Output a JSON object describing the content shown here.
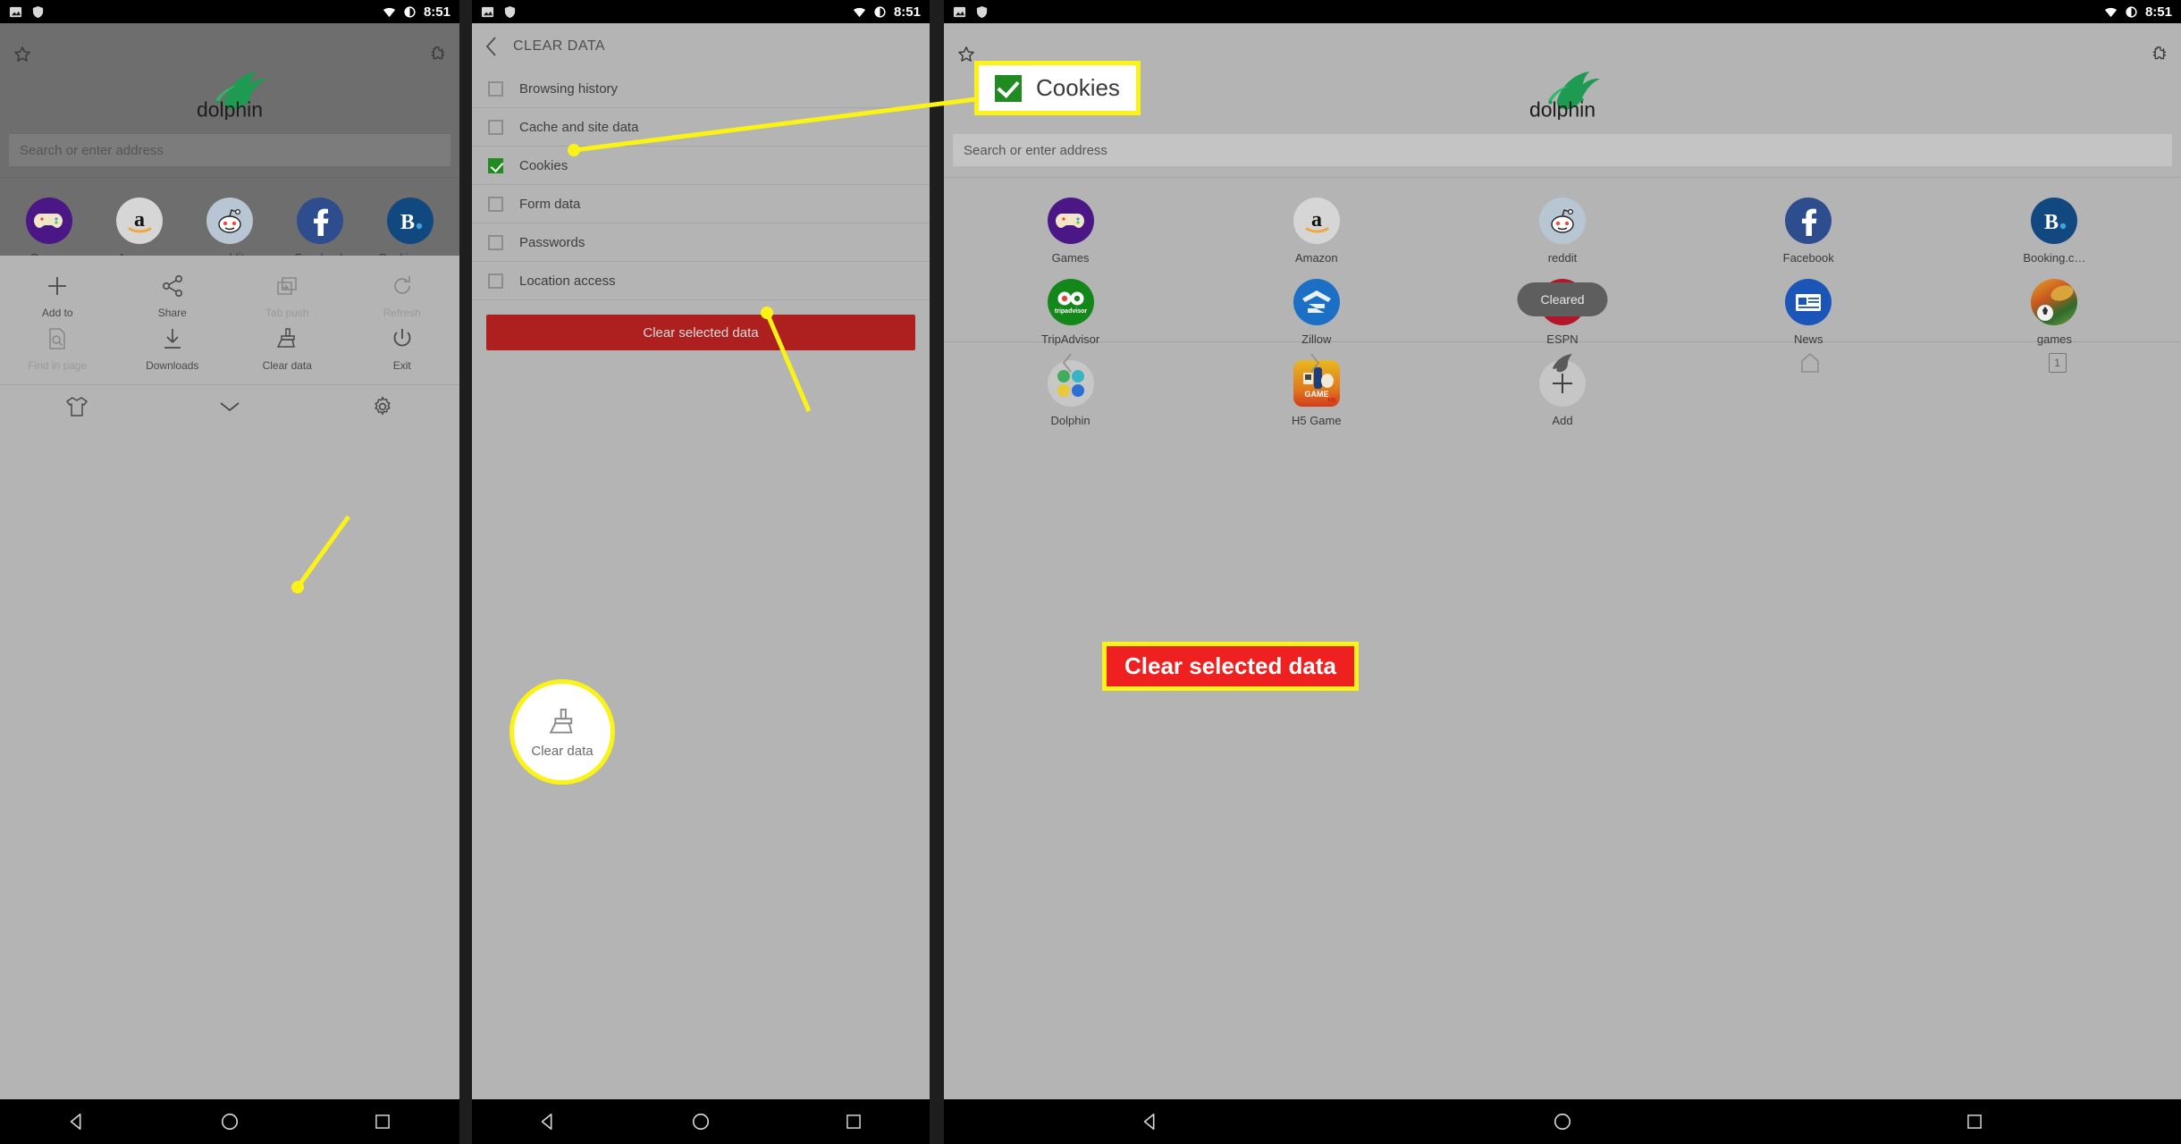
{
  "statusbar": {
    "time": "8:51",
    "icons": [
      "image-icon",
      "shield-icon",
      "wifi-icon",
      "battery-icon"
    ]
  },
  "browser": {
    "brand": "dolphin",
    "address_placeholder": "Search or enter address",
    "star_icon": "bookmark-star-icon",
    "puzzle_icon": "addon-puzzle-icon",
    "speed_dial": [
      {
        "label": "Games",
        "icon": "games-controller-icon"
      },
      {
        "label": "Amazon",
        "icon": "amazon-icon"
      },
      {
        "label": "reddit",
        "icon": "reddit-icon"
      },
      {
        "label": "Facebook",
        "icon": "facebook-icon"
      },
      {
        "label": "Booking.c…",
        "icon": "booking-icon"
      },
      {
        "label": "TripAdvisor",
        "icon": "tripadvisor-icon"
      },
      {
        "label": "Zillow",
        "icon": "zillow-icon"
      },
      {
        "label": "ESPN",
        "icon": "espn-icon"
      },
      {
        "label": "News",
        "icon": "news-icon"
      },
      {
        "label": "games",
        "icon": "games-photo-icon"
      },
      {
        "label": "Dolphin",
        "icon": "dolphin-folder-icon"
      },
      {
        "label": "H5 Game",
        "icon": "h5-game-icon"
      },
      {
        "label": "Add",
        "icon": "plus-icon"
      }
    ]
  },
  "menu_sheet": {
    "items": [
      {
        "label": "Add to",
        "icon": "plus-icon",
        "disabled": false
      },
      {
        "label": "Share",
        "icon": "share-icon",
        "disabled": false
      },
      {
        "label": "Tab push",
        "icon": "tab-push-icon",
        "disabled": true
      },
      {
        "label": "Refresh",
        "icon": "refresh-icon",
        "disabled": true
      },
      {
        "label": "Find in page",
        "icon": "find-page-icon",
        "disabled": true
      },
      {
        "label": "Downloads",
        "icon": "download-icon",
        "disabled": false
      },
      {
        "label": "Clear data",
        "icon": "broom-icon",
        "disabled": false
      },
      {
        "label": "Exit",
        "icon": "power-icon",
        "disabled": false
      }
    ],
    "footer_icons": [
      "tshirt-theme-icon",
      "chevron-down-icon",
      "gear-settings-icon"
    ]
  },
  "clear_data_screen": {
    "title": "CLEAR DATA",
    "back_icon": "chevron-left-icon",
    "options": [
      {
        "label": "Browsing history",
        "checked": false
      },
      {
        "label": "Cache and site data",
        "checked": false
      },
      {
        "label": "Cookies",
        "checked": true
      },
      {
        "label": "Form data",
        "checked": false
      },
      {
        "label": "Passwords",
        "checked": false
      },
      {
        "label": "Location access",
        "checked": false
      }
    ],
    "action_button": "Clear selected data"
  },
  "result_screen": {
    "toast": "Cleared",
    "bottom_nav": [
      {
        "icon": "back-chevron-icon",
        "label": ""
      },
      {
        "icon": "forward-chevron-icon",
        "label": ""
      },
      {
        "icon": "dolphin-icon",
        "label": ""
      },
      {
        "icon": "home-icon",
        "label": ""
      },
      {
        "icon": "tab-count-icon",
        "label": "1"
      }
    ]
  },
  "annotations": {
    "cookies_callout": "Cookies",
    "clear_data_callout": "Clear data",
    "clear_selected_callout": "Clear selected data",
    "highlight_color": "#fbf315",
    "red_color": "#ef2020",
    "check_green": "#1f8b20"
  },
  "android_nav": {
    "back": "triangle-back-icon",
    "home": "circle-home-icon",
    "recents": "square-recents-icon"
  }
}
